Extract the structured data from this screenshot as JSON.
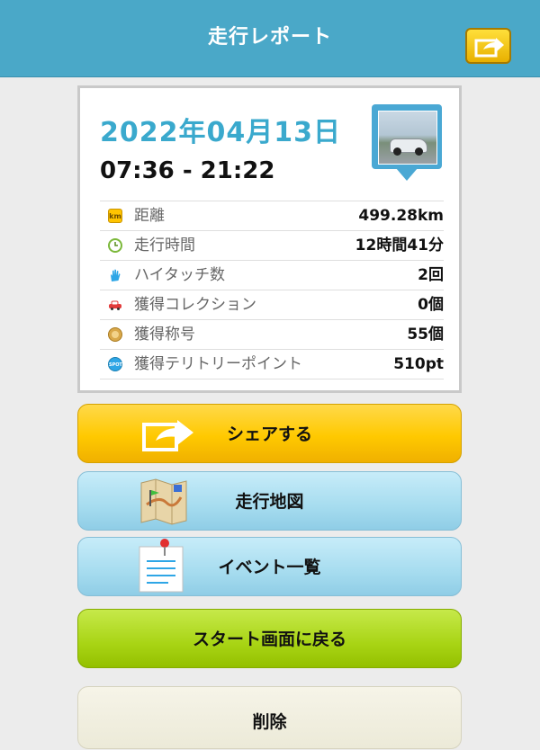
{
  "header": {
    "title": "走行レポート",
    "share_icon": "share-icon"
  },
  "report": {
    "date": "2022年04月13日",
    "time_range": "07:36 - 21:22",
    "photo_icon": "car-photo"
  },
  "stats": [
    {
      "icon": "km-icon",
      "icon_text": "km",
      "label": "距離",
      "value": "499.28km"
    },
    {
      "icon": "clock-icon",
      "icon_text": "",
      "label": "走行時間",
      "value": "12時間41分"
    },
    {
      "icon": "hand-icon",
      "icon_text": "",
      "label": "ハイタッチ数",
      "value": "2回"
    },
    {
      "icon": "car-icon",
      "icon_text": "",
      "label": "獲得コレクション",
      "value": "0個"
    },
    {
      "icon": "medal-icon",
      "icon_text": "",
      "label": "獲得称号",
      "value": "55個"
    },
    {
      "icon": "spot-icon",
      "icon_text": "SPOT",
      "label": "獲得テリトリーポイント",
      "value": "510pt"
    }
  ],
  "buttons": {
    "share": "シェアする",
    "map": "走行地図",
    "events": "イベント一覧",
    "start": "スタート画面に戻る",
    "delete": "削除"
  },
  "colors": {
    "header": "#4aa8c8",
    "date": "#3aa9cd",
    "share_button": "#ffc900",
    "blue_button": "#a6dcef",
    "green_button": "#a8d414"
  }
}
